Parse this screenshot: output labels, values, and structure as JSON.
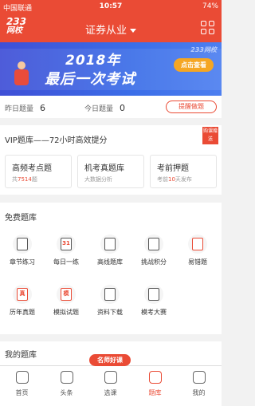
{
  "status": {
    "carrier": "中国联通",
    "time": "10:57",
    "battery": "74%"
  },
  "header": {
    "logo_top": "233",
    "logo_bottom": "网校",
    "exam_name": "证券从业"
  },
  "banner": {
    "line1": "2018年",
    "line2": "最后一次考试",
    "button": "点击查看",
    "watermark": "233网校"
  },
  "stats": {
    "yesterday_label": "昨日题量",
    "yesterday_value": "6",
    "today_label": "今日题量",
    "today_value": "0",
    "remind": "提醒做题"
  },
  "vip": {
    "title": "VIP题库——72小时高效提分",
    "tag": "购课赠送",
    "cards": [
      {
        "name": "高频考点题",
        "desc_prefix": "共",
        "desc_highlight": "7514",
        "desc_suffix": "题"
      },
      {
        "name": "机考真题库",
        "desc_prefix": "大数据分析",
        "desc_highlight": "",
        "desc_suffix": ""
      },
      {
        "name": "考前押题",
        "desc_prefix": "考前",
        "desc_highlight": "10",
        "desc_suffix": "天发布"
      }
    ]
  },
  "free": {
    "title": "免费题库",
    "items": [
      {
        "label": "章节练习",
        "glyph": ""
      },
      {
        "label": "每日一练",
        "glyph": "31"
      },
      {
        "label": "高线题库",
        "glyph": ""
      },
      {
        "label": "挑战积分",
        "glyph": ""
      },
      {
        "label": "易错题",
        "glyph": ""
      },
      {
        "label": "历年真题",
        "glyph": "真"
      },
      {
        "label": "模拟试题",
        "glyph": "模"
      },
      {
        "label": "资料下载",
        "glyph": ""
      },
      {
        "label": "模考大赛",
        "glyph": ""
      }
    ]
  },
  "mine": {
    "title": "我的题库",
    "promo": "名师好课"
  },
  "tabs": [
    {
      "label": "首页"
    },
    {
      "label": "头条"
    },
    {
      "label": "选课"
    },
    {
      "label": "题库"
    },
    {
      "label": "我的"
    }
  ],
  "colors": {
    "accent": "#ea4b35",
    "banner": "#3f4fd6"
  }
}
